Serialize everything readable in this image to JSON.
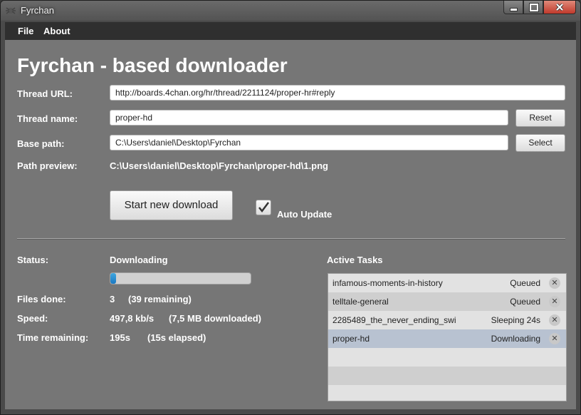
{
  "window": {
    "title": "Fyrchan",
    "icon": "gear-spider-icon"
  },
  "menu": [
    {
      "label": "File"
    },
    {
      "label": "About"
    }
  ],
  "heading": "Fyrchan - based downloader",
  "form": {
    "thread_url": {
      "label": "Thread URL:",
      "value": "http://boards.4chan.org/hr/thread/2211124/proper-hr#reply"
    },
    "thread_name": {
      "label": "Thread name:",
      "value": "proper-hd",
      "button": "Reset"
    },
    "base_path": {
      "label": "Base path:",
      "value": "C:\\Users\\daniel\\Desktop\\Fyrchan",
      "button": "Select"
    },
    "path_preview": {
      "label": "Path preview:",
      "value": "C:\\Users\\daniel\\Desktop\\Fyrchan\\proper-hd\\1.png"
    }
  },
  "actions": {
    "start_label": "Start new download",
    "auto_update_label": "Auto Update",
    "auto_update_checked": true
  },
  "status": {
    "status_label": "Status:",
    "status_value": "Downloading",
    "progress_fraction": 0.03,
    "files_label": "Files done:",
    "files_value": "3",
    "files_remaining": "(39 remaining)",
    "speed_label": "Speed:",
    "speed_value": "497,8 kb/s",
    "speed_downloaded": "(7,5 MB downloaded)",
    "time_label": "Time remaining:",
    "time_value": "195s",
    "time_elapsed": "(15s elapsed)"
  },
  "tasks": {
    "title": "Active Tasks",
    "items": [
      {
        "name": "infamous-moments-in-history",
        "status": "Queued",
        "selected": false
      },
      {
        "name": "telltale-general",
        "status": "Queued",
        "selected": false
      },
      {
        "name": "2285489_the_never_ending_swi",
        "status": "Sleeping 24s",
        "selected": false
      },
      {
        "name": "proper-hd",
        "status": "Downloading",
        "selected": true
      }
    ]
  },
  "colors": {
    "selected_row": "#b8c2d1",
    "row_alt": "#cfcfcf",
    "progress": "#1a78c2"
  }
}
